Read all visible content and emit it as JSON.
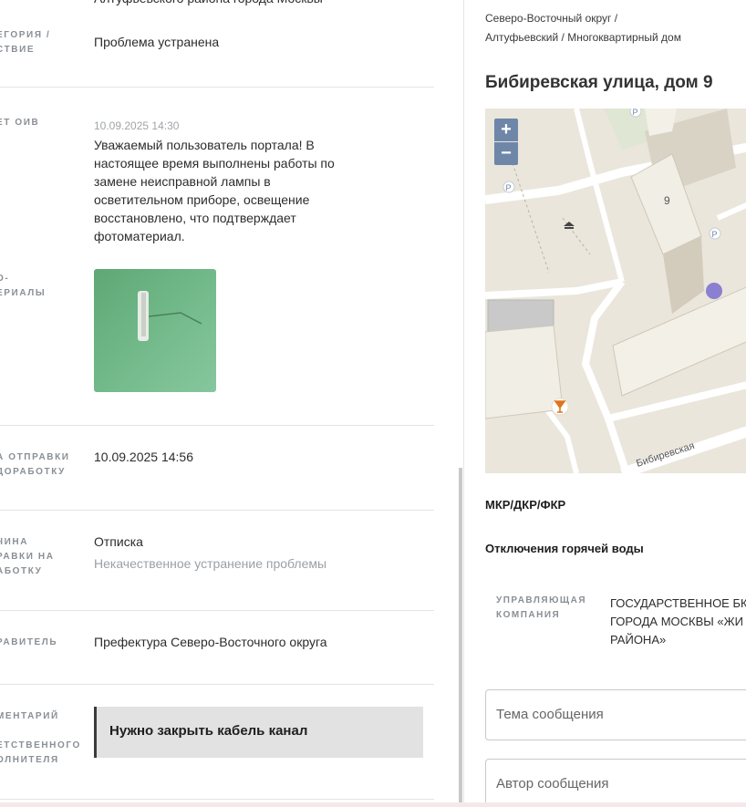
{
  "left": {
    "top_cut_text": "Алтуфьевского района города Москвы",
    "category_label": "ЕГОРИЯ / ТВИЕ",
    "category_label_lines": [
      "ЕГОРИЯ /",
      "СТВИЕ"
    ],
    "category_value": "Проблема устранена",
    "answer_label": "ЕТ ОИВ",
    "answer_date": "10.09.2025 14:30",
    "answer_text_lines": [
      "Уважаемый пользователь портала! В",
      "настоящее время выполнены работы по",
      "замене неисправной лампы в",
      "осветительном приборе, освещение",
      "восстановлено, что подтверждает",
      "фотоматериал."
    ],
    "photo_label_lines": [
      "О-",
      "ЕРИАЛЫ"
    ],
    "sent_label_lines": [
      "А ОТПРАВКИ",
      "ДОРАБОТКУ"
    ],
    "sent_value": "10.09.2025 14:56",
    "reason_label_lines": [
      "ЧИНА",
      "РАВКИ НА",
      "АБОТКУ"
    ],
    "reason_value": "Отписка",
    "reason_sub": "Некачественное устранение проблемы",
    "sender_label": "РАВИТЕЛЬ",
    "sender_value": "Префектура Северо-Восточного округа",
    "comment_label_lines": [
      "МЕНТАРИЙ",
      "",
      "ЕТСТВЕННОГО",
      "ОЛНИТЕЛЯ"
    ],
    "comment_value": "Нужно закрыть кабель канал"
  },
  "right": {
    "crumb_line1": "Северо-Восточный округ /",
    "crumb_line2": "Алтуфьевский / Многоквартирный дом",
    "address": "Бибиревская улица, дом 9",
    "map": {
      "zoom_in": "+",
      "zoom_out": "−",
      "building_number": "9",
      "street_label": "Бибиревская",
      "parking_label": "P"
    },
    "section_mkr": "МКР/ДКР/ФКР",
    "section_hotwater": "Отключения горячей воды",
    "mc_label_lines": [
      "УПРАВЛЯЮЩАЯ",
      "КОМПАНИЯ"
    ],
    "mc_value_lines": [
      "ГОСУДАРСТВЕННОЕ БК",
      "ГОРОДА МОСКВЫ «ЖИ",
      "РАЙОНА»"
    ],
    "subject_placeholder": "Тема сообщения",
    "author_placeholder": "Автор сообщения"
  },
  "colors": {
    "accent_marker": "#8b7fd1",
    "zoom_button": "#6e87a8",
    "comment_bg": "#e2e2e2"
  }
}
